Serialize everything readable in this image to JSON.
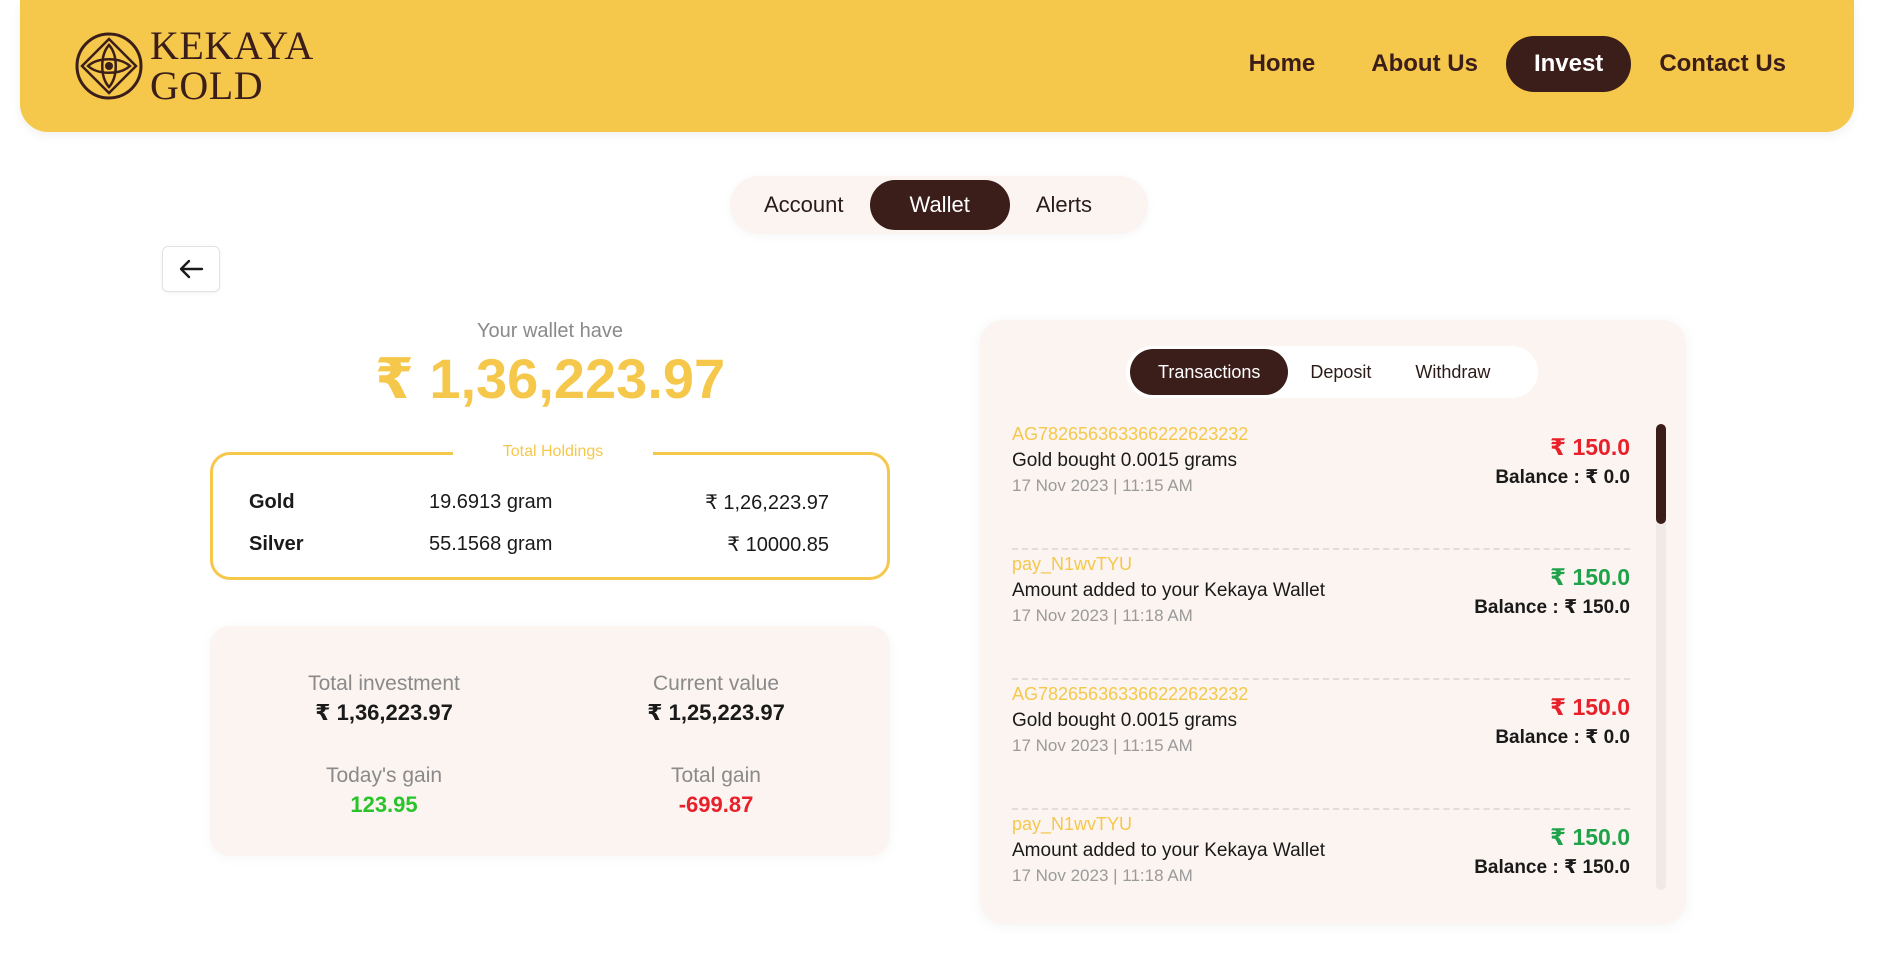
{
  "brand": {
    "logo_line1": "KEKAYA",
    "logo_line2": "GOLD",
    "colors": {
      "primary_yellow": "#f5c84c",
      "dark_brown": "#3b1d1a",
      "negative": "#e8202a",
      "positive": "#1fa24a"
    }
  },
  "nav": {
    "items": [
      {
        "label": "Home",
        "active": false
      },
      {
        "label": "About Us",
        "active": false
      },
      {
        "label": "Invest",
        "active": true
      },
      {
        "label": "Contact Us",
        "active": false
      }
    ]
  },
  "main_tabs": [
    {
      "label": "Account",
      "active": false
    },
    {
      "label": "Wallet",
      "active": true
    },
    {
      "label": "Alerts",
      "active": false
    }
  ],
  "back_button": {
    "icon": "arrow-left-icon"
  },
  "wallet": {
    "label": "Your wallet have",
    "amount": "₹ 1,36,223.97"
  },
  "holdings": {
    "title": "Total Holdings",
    "rows": [
      {
        "name": "Gold",
        "quantity": "19.6913 gram",
        "value": "₹ 1,26,223.97"
      },
      {
        "name": "Silver",
        "quantity": "55.1568 gram",
        "value": "₹ 10000.85"
      }
    ]
  },
  "stats": {
    "total_investment": {
      "label": "Total investment",
      "value": "₹ 1,36,223.97"
    },
    "current_value": {
      "label": "Current value",
      "value": "₹ 1,25,223.97"
    },
    "todays_gain": {
      "label": "Today's gain",
      "value": "123.95"
    },
    "total_gain": {
      "label": "Total gain",
      "value": "-699.87"
    }
  },
  "tx_tabs": [
    {
      "label": "Transactions",
      "active": true
    },
    {
      "label": "Deposit",
      "active": false
    },
    {
      "label": "Withdraw",
      "active": false
    }
  ],
  "transactions": [
    {
      "id": "AG782656363366222623232",
      "description": "Gold bought 0.0015 grams",
      "datetime": "17 Nov 2023 | 11:15 AM",
      "amount": "₹ 150.0",
      "type": "debit",
      "balance": "Balance : ₹ 0.0"
    },
    {
      "id": "pay_N1wvTYU",
      "description": "Amount added to your Kekaya Wallet",
      "datetime": "17 Nov 2023 | 11:18 AM",
      "amount": "₹ 150.0",
      "type": "credit",
      "balance": "Balance : ₹ 150.0"
    },
    {
      "id": "AG782656363366222623232",
      "description": "Gold bought 0.0015 grams",
      "datetime": "17 Nov 2023 | 11:15 AM",
      "amount": "₹ 150.0",
      "type": "debit",
      "balance": "Balance : ₹ 0.0"
    },
    {
      "id": "pay_N1wvTYU",
      "description": "Amount added to your Kekaya Wallet",
      "datetime": "17 Nov 2023 | 11:18 AM",
      "amount": "₹ 150.0",
      "type": "credit",
      "balance": "Balance : ₹ 150.0"
    }
  ]
}
